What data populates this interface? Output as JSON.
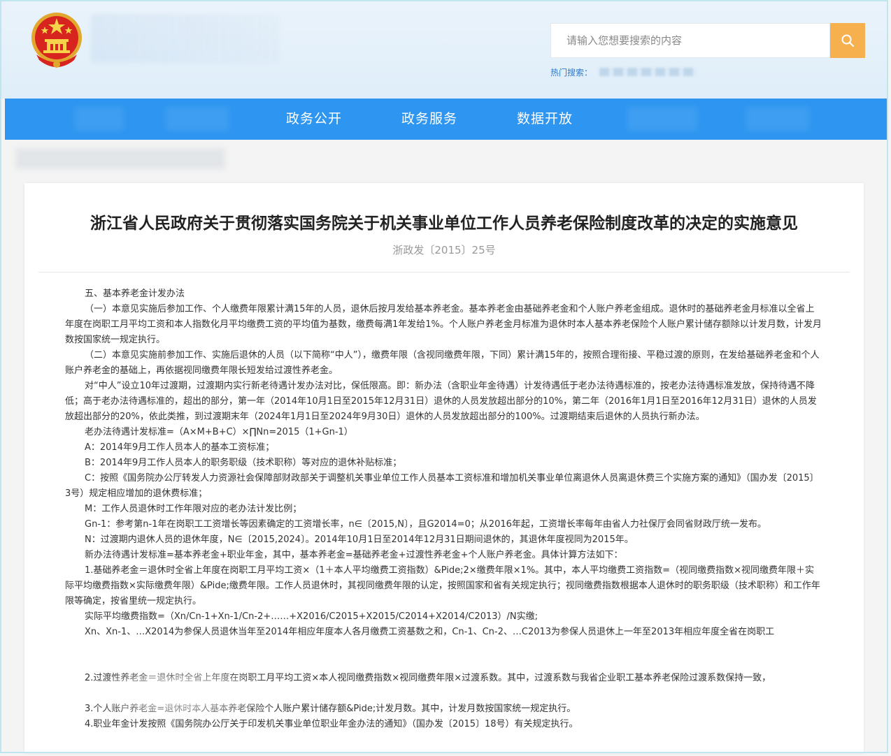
{
  "header": {
    "search_placeholder": "请输入您想要搜索的内容",
    "hot_label": "热门搜索："
  },
  "nav": {
    "items": [
      "政务公开",
      "政务服务",
      "数据开放"
    ]
  },
  "article": {
    "title": "浙江省人民政府关于贯彻落实国务院关于机关事业单位工作人员养老保险制度改革的决定的实施意见",
    "doc_number": "浙政发〔2015〕25号",
    "paragraphs": [
      "五、基本养老金计发办法",
      "（一）本意见实施后参加工作、个人缴费年限累计满15年的人员，退休后按月发给基本养老金。基本养老金由基础养老金和个人账户养老金组成。退休时的基础养老金月标准以全省上年度在岗职工月平均工资和本人指数化月平均缴费工资的平均值为基数，缴费每满1年发给1%。个人账户养老金月标准为退休时本人基本养老保险个人账户累计储存额除以计发月数，计发月数按国家统一规定执行。",
      "（二）本意见实施前参加工作、实施后退休的人员（以下简称“中人”），缴费年限（含视同缴费年限，下同）累计满15年的，按照合理衔接、平稳过渡的原则，在发给基础养老金和个人账户养老金的基础上，再依据视同缴费年限长短发给过渡性养老金。",
      "对“中人”设立10年过渡期，过渡期内实行新老待遇计发办法对比，保低限高。即：新办法（含职业年金待遇）计发待遇低于老办法待遇标准的，按老办法待遇标准发放，保持待遇不降低；高于老办法待遇标准的，超出的部分，第一年（2014年10月1日至2015年12月31日）退休的人员发放超出部分的10%，第二年（2016年1月1日至2016年12月31日）退休的人员发放超出部分的20%，依此类推，到过渡期末年（2024年1月1日至2024年9月30日）退休的人员发放超出部分的100%。过渡期结束后退休的人员执行新办法。",
      "老办法待遇计发标准=（A×M+B+C）×∏Nn=2015（1+Gn-1）",
      "A：2014年9月工作人员本人的基本工资标准；",
      "B：2014年9月工作人员本人的职务职级（技术职称）等对应的退休补贴标准；",
      "C：按照《国务院办公厅转发人力资源社会保障部财政部关于调整机关事业单位工作人员基本工资标准和增加机关事业单位离退休人员离退休费三个实施方案的通知》（国办发〔2015〕3号）规定相应增加的退休费标准；",
      "M：工作人员退休时工作年限对应的老办法计发比例；",
      "Gn-1：参考第n-1年在岗职工工资增长等因素确定的工资增长率，n∈〔2015,N〕，且G2014=0；从2016年起，工资增长率每年由省人力社保厅会同省财政厅统一发布。",
      "N：过渡期内退休人员的退休年度，N∈〔2015,2024〕。2014年10月1日至2014年12月31日期间退休的，其退休年度视同为2015年。",
      "新办法待遇计发标准=基本养老金+职业年金，其中，基本养老金=基础养老金+过渡性养老金+个人账户养老金。具体计算方法如下：",
      "1.基础养老金＝退休时全省上年度在岗职工月平均工资×（1＋本人平均缴费工资指数）&Pide;2×缴费年限×1%。其中，本人平均缴费工资指数=（视同缴费指数×视同缴费年限＋实际平均缴费指数×实际缴费年限）&Pide;缴费年限。工作人员退休时，其视同缴费年限的认定，按照国家和省有关规定执行；视同缴费指数根据本人退休时的职务职级（技术职称）和工作年限等确定，按省里统一规定执行。",
      "实际平均缴费指数=（Xn/Cn-1+Xn-1/Cn-2+……+X2016/C2015+X2015/C2014+X2014/C2013）/N实缴;",
      "Xn、Xn-1、…X2014为参保人员退休当年至2014年相应年度本人各月缴费工资基数之和，Cn-1、Cn-2、…C2013为参保人员退休上一年至2013年相应年度全省在岗职工",
      "2.过渡性养老金＝退休时全省上年度在岗职工月平均工资×本人视同缴费指数×视同缴费年限×过渡系数。其中，过渡系数与我省企业职工基本养老保险过渡系数保持一致，",
      "3.个人账户养老金=退休时本人基本养老保险个人账户累计储存额&Pide;计发月数。其中，计发月数按国家统一规定执行。",
      "4.职业年金计发按照《国务院办公厅关于印发机关事业单位职业年金办法的通知》（国办发〔2015〕18号）有关规定执行。"
    ]
  },
  "colors": {
    "nav_bg": "#2e96f0",
    "search_button": "#f6b04d",
    "hot_label": "#2d7ac8"
  }
}
